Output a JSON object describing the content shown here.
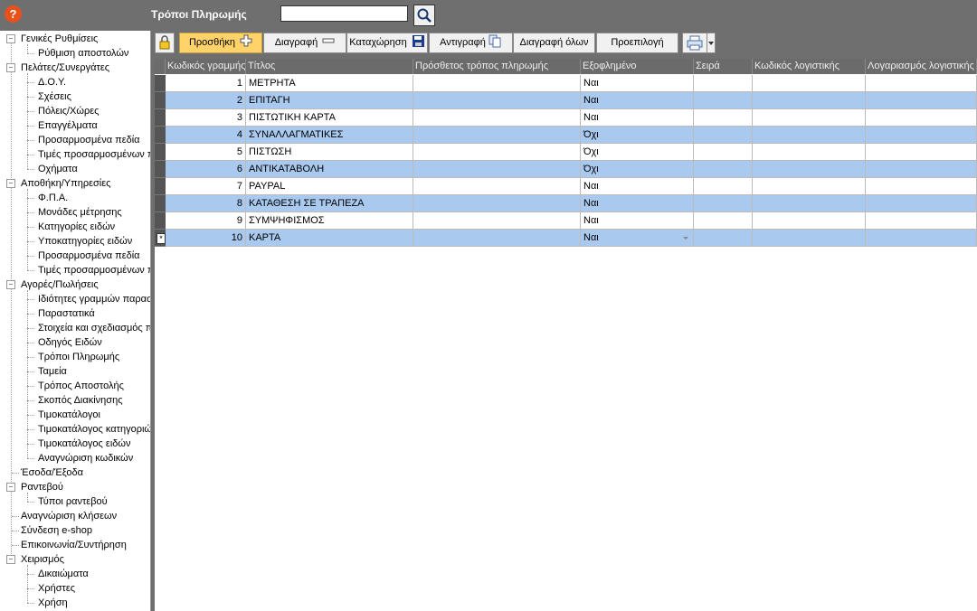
{
  "header": {
    "help_label": "?",
    "title": "Τρόποι Πληρωμής",
    "search_value": ""
  },
  "tree": {
    "nodes": [
      {
        "label": "Γενικές Ρυθμίσεις",
        "level": 0,
        "expanded": true
      },
      {
        "label": "Ρύθμιση αποστολών",
        "level": 1
      },
      {
        "label": "Πελάτες/Συνεργάτες",
        "level": 0,
        "expanded": true
      },
      {
        "label": "Δ.Ο.Υ.",
        "level": 1
      },
      {
        "label": "Σχέσεις",
        "level": 1
      },
      {
        "label": "Πόλεις/Χώρες",
        "level": 1
      },
      {
        "label": "Επαγγέλματα",
        "level": 1
      },
      {
        "label": "Προσαρμοσμένα πεδία",
        "level": 1
      },
      {
        "label": "Τιμές προσαρμοσμένων πεδίων",
        "level": 1
      },
      {
        "label": "Οχήματα",
        "level": 1
      },
      {
        "label": "Αποθήκη/Υπηρεσίες",
        "level": 0,
        "expanded": true
      },
      {
        "label": "Φ.Π.Α.",
        "level": 1
      },
      {
        "label": "Μονάδες μέτρησης",
        "level": 1
      },
      {
        "label": "Κατηγορίες ειδών",
        "level": 1
      },
      {
        "label": "Υποκατηγορίες ειδών",
        "level": 1
      },
      {
        "label": "Προσαρμοσμένα πεδία",
        "level": 1
      },
      {
        "label": "Τιμές προσαρμοσμένων πεδίων",
        "level": 1
      },
      {
        "label": "Αγορές/Πωλήσεις",
        "level": 0,
        "expanded": true
      },
      {
        "label": "Ιδιότητες γραμμών παραστατικών",
        "level": 1
      },
      {
        "label": "Παραστατικά",
        "level": 1
      },
      {
        "label": "Στοιχεία και σχεδιασμός παραστατικών",
        "level": 1
      },
      {
        "label": "Οδηγός Ειδών",
        "level": 1
      },
      {
        "label": "Τρόποι Πληρωμής",
        "level": 1
      },
      {
        "label": "Ταμεία",
        "level": 1
      },
      {
        "label": "Τρόπος Αποστολής",
        "level": 1
      },
      {
        "label": "Σκοπός Διακίνησης",
        "level": 1
      },
      {
        "label": "Τιμοκατάλογοι",
        "level": 1
      },
      {
        "label": "Τιμοκατάλογος κατηγοριών",
        "level": 1
      },
      {
        "label": "Τιμοκατάλογος ειδών",
        "level": 1
      },
      {
        "label": "Αναγνώριση κωδικών",
        "level": 1
      },
      {
        "label": "Έσοδα/Έξοδα",
        "level": 0,
        "leaf": true
      },
      {
        "label": "Ραντεβού",
        "level": 0,
        "expanded": true
      },
      {
        "label": "Τύποι ραντεβού",
        "level": 1
      },
      {
        "label": "Αναγνώριση κλήσεων",
        "level": 0,
        "leaf": true
      },
      {
        "label": "Σύνδεση e-shop",
        "level": 0,
        "leaf": true
      },
      {
        "label": "Επικοινωνία/Συντήρηση",
        "level": 0,
        "leaf": true
      },
      {
        "label": "Χειρισμός",
        "level": 0,
        "expanded": true
      },
      {
        "label": "Δικαιώματα",
        "level": 1
      },
      {
        "label": "Χρήστες",
        "level": 1
      },
      {
        "label": "Χρήση",
        "level": 1
      }
    ]
  },
  "toolbar": {
    "add": "Προσθήκη",
    "delete": "Διαγραφή",
    "save": "Καταχώρηση",
    "copy": "Αντιγραφή",
    "delete_all": "Διαγραφή όλων",
    "default": "Προεπιλογή"
  },
  "grid": {
    "columns": [
      "Κωδικός γραμμής",
      "Τίτλος",
      "Πρόσθετος τρόπος πληρωμής",
      "Εξοφλημένο",
      "Σειρά",
      "Κωδικός λογιστικής",
      "Λογαριασμός λογιστικής"
    ],
    "rows": [
      {
        "code": "1",
        "title": "ΜΕΤΡΗΤΑ",
        "extra": "",
        "paid": "Ναι",
        "series": "",
        "acc_code": "",
        "acc": ""
      },
      {
        "code": "2",
        "title": "ΕΠΙΤΑΓΗ",
        "extra": "",
        "paid": "Ναι",
        "series": "",
        "acc_code": "",
        "acc": ""
      },
      {
        "code": "3",
        "title": "ΠΙΣΤΩΤΙΚΗ ΚΑΡΤΑ",
        "extra": "",
        "paid": "Ναι",
        "series": "",
        "acc_code": "",
        "acc": ""
      },
      {
        "code": "4",
        "title": "ΣΥΝΑΛΛΑΓΜΑΤΙΚΕΣ",
        "extra": "",
        "paid": "Όχι",
        "series": "",
        "acc_code": "",
        "acc": ""
      },
      {
        "code": "5",
        "title": "ΠΙΣΤΩΣΗ",
        "extra": "",
        "paid": "Όχι",
        "series": "",
        "acc_code": "",
        "acc": ""
      },
      {
        "code": "6",
        "title": "ΑΝΤΙΚΑΤΑΒΟΛΗ",
        "extra": "",
        "paid": "Όχι",
        "series": "",
        "acc_code": "",
        "acc": ""
      },
      {
        "code": "7",
        "title": "PAYPAL",
        "extra": "",
        "paid": "Ναι",
        "series": "",
        "acc_code": "",
        "acc": ""
      },
      {
        "code": "8",
        "title": "ΚΑΤΑΘΕΣΗ ΣΕ ΤΡΑΠΕΖΑ",
        "extra": "",
        "paid": "Ναι",
        "series": "",
        "acc_code": "",
        "acc": ""
      },
      {
        "code": "9",
        "title": "ΣΥΜΨΗΦΙΣΜΟΣ",
        "extra": "",
        "paid": "Ναι",
        "series": "",
        "acc_code": "",
        "acc": ""
      },
      {
        "code": "10",
        "title": "ΚΑΡΤΑ",
        "extra": "",
        "paid": "Ναι",
        "series": "",
        "acc_code": "",
        "acc": ""
      }
    ],
    "new_row_marker": "*"
  },
  "colors": {
    "alt_row": "#a9c9ef",
    "row": "#ffffff",
    "header_bg": "#6b6b6b",
    "add_button": "#ffd36a"
  }
}
